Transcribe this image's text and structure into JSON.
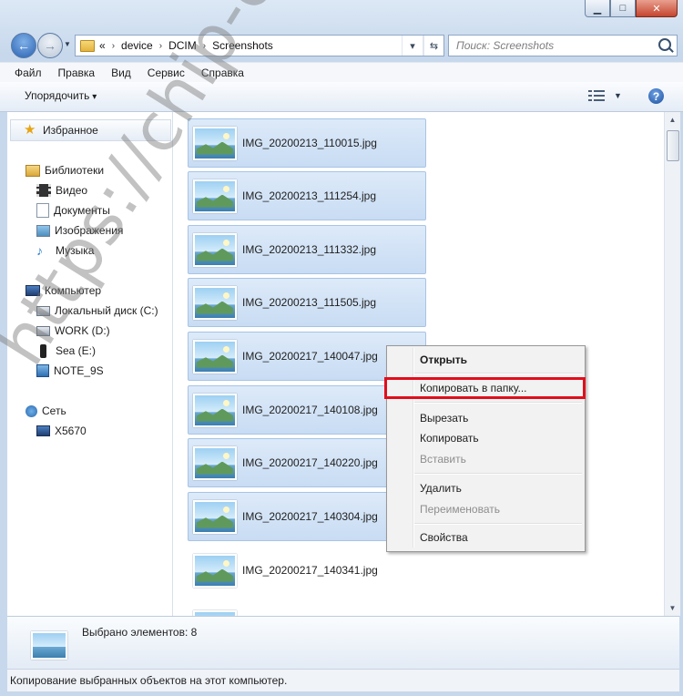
{
  "title_buttons": {
    "minimize": "▁",
    "maximize": "□",
    "close": "✕"
  },
  "address": {
    "overflow": "«",
    "crumbs": [
      "device",
      "DCIM",
      "Screenshots"
    ],
    "search_placeholder": "Поиск: Screenshots"
  },
  "menu": [
    "Файл",
    "Правка",
    "Вид",
    "Сервис",
    "Справка"
  ],
  "toolbar": {
    "organize": "Упорядочить",
    "help": "?"
  },
  "nav": {
    "favorites": "Избранное",
    "libraries": "Библиотеки",
    "video": "Видео",
    "documents": "Документы",
    "images": "Изображения",
    "music": "Музыка",
    "computer": "Компьютер",
    "local_disk": "Локальный диск (C:)",
    "work": "WORK (D:)",
    "sea": "Sea (E:)",
    "note": "NOTE_9S",
    "network": "Сеть",
    "x5670": "X5670"
  },
  "files": [
    {
      "name": "IMG_20200213_110015.jpg",
      "selected": true
    },
    {
      "name": "IMG_20200213_111254.jpg",
      "selected": true
    },
    {
      "name": "IMG_20200213_111332.jpg",
      "selected": true
    },
    {
      "name": "IMG_20200213_111505.jpg",
      "selected": true
    },
    {
      "name": "IMG_20200217_140047.jpg",
      "selected": true
    },
    {
      "name": "IMG_20200217_140108.jpg",
      "selected": true
    },
    {
      "name": "IMG_20200217_140220.jpg",
      "selected": true
    },
    {
      "name": "IMG_20200217_140304.jpg",
      "selected": true
    },
    {
      "name": "IMG_20200217_140341.jpg",
      "selected": false
    }
  ],
  "context_menu": {
    "open": "Открыть",
    "copy_to_folder": "Копировать в папку...",
    "cut": "Вырезать",
    "copy": "Копировать",
    "paste": "Вставить",
    "delete": "Удалить",
    "rename": "Переименовать",
    "properties": "Свойства"
  },
  "details": {
    "selected_count": "Выбрано элементов: 8"
  },
  "status": {
    "text": "Копирование выбранных объектов на этот компьютер."
  },
  "watermark": "https://chip-center.ru",
  "colors": {
    "highlight_box": "#e10e1c",
    "selection": "#cfe0f5"
  }
}
